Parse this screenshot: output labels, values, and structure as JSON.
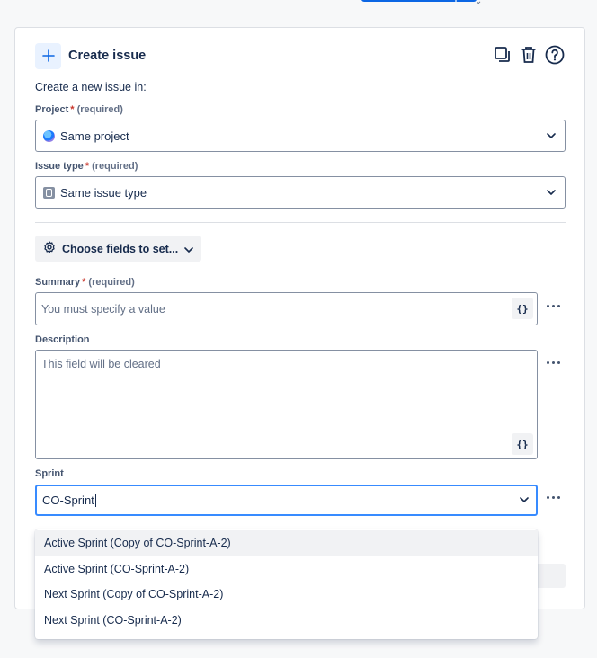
{
  "header": {
    "title": "Create issue"
  },
  "intro": "Create a new issue in:",
  "project": {
    "label": "Project",
    "required_mark": "*",
    "required_text": "(required)",
    "value": "Same project"
  },
  "issue_type": {
    "label": "Issue type",
    "required_mark": "*",
    "required_text": "(required)",
    "value": "Same issue type"
  },
  "choose_fields": {
    "label": "Choose fields to set..."
  },
  "summary": {
    "label": "Summary",
    "required_mark": "*",
    "required_text": "(required)",
    "placeholder": "You must specify a value",
    "smart_value": "{}"
  },
  "description": {
    "label": "Description",
    "placeholder": "This field will be cleared",
    "smart_value": "{}"
  },
  "sprint": {
    "label": "Sprint",
    "value": "CO-Sprint",
    "options": [
      "Active Sprint (Copy of CO-Sprint-A-2)",
      "Active Sprint (CO-Sprint-A-2)",
      "Next Sprint (Copy of CO-Sprint-A-2)",
      "Next Sprint (CO-Sprint-A-2)"
    ]
  },
  "colors": {
    "accent": "#0c66e4",
    "focus": "#388bff",
    "required": "#c9372c"
  }
}
